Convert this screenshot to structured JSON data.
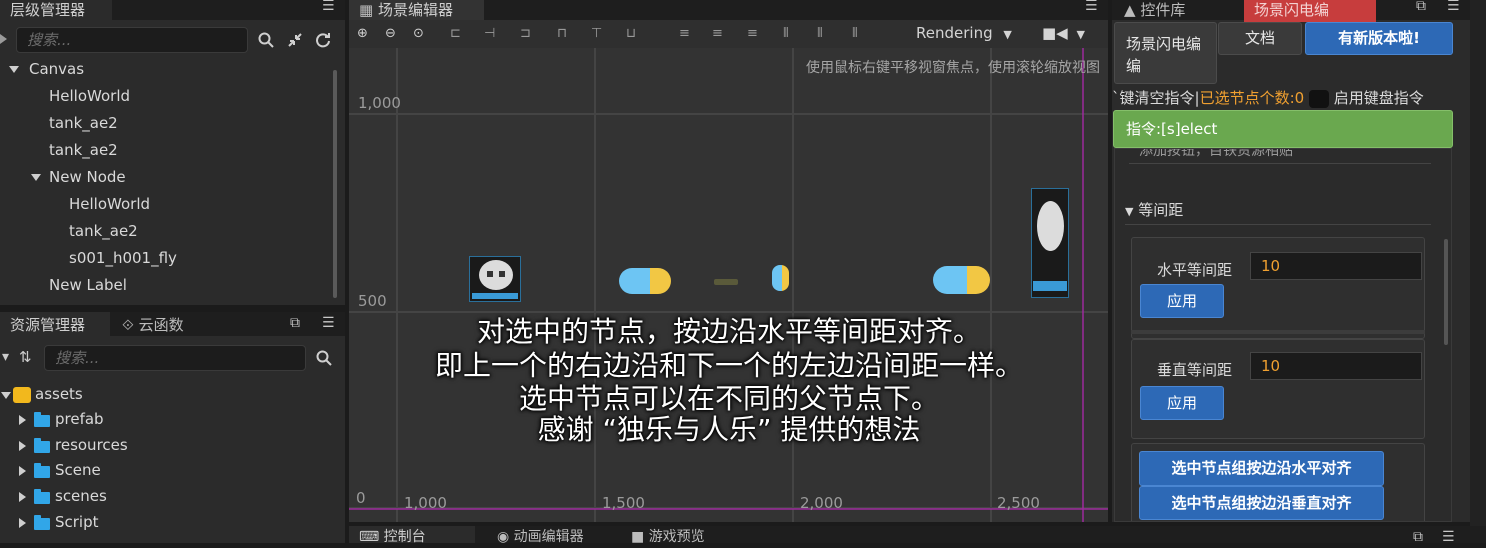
{
  "hierarchy": {
    "title": "层级管理器",
    "search_placeholder": "搜索...",
    "nodes": [
      "Canvas",
      "HelloWorld",
      "tank_ae2",
      "tank_ae2",
      "New Node",
      "HelloWorld",
      "tank_ae2",
      "s001_h001_fly",
      "New Label"
    ]
  },
  "assets": {
    "title": "资源管理器",
    "tab2": "云函数",
    "search_placeholder": "搜索...",
    "items": [
      "assets",
      "prefab",
      "resources",
      "Scene",
      "scenes",
      "Script"
    ]
  },
  "scene": {
    "title": "场景编辑器",
    "rendering": "Rendering",
    "hint": "使用鼠标右键平移视窗焦点，使用滚轮缩放视图",
    "y_labels": [
      "1,000",
      "500",
      "0"
    ],
    "x_labels": [
      "1,000",
      "1,500",
      "2,000",
      "2,500"
    ],
    "overlay": [
      "对选中的节点，按边沿水平等间距对齐。",
      "即上一个的右边沿和下一个的左边沿间距一样。",
      "选中节点可以在不同的父节点下。",
      "感谢 “独乐与人乐” 提供的想法"
    ]
  },
  "bottom_tabs": [
    "控制台",
    "动画编辑器",
    "游戏预览"
  ],
  "right": {
    "tab1": "控件库",
    "tab2": "场景闪电编",
    "btn_main": "场景闪电编",
    "btn_main2": "编",
    "btn_docs": "文档",
    "btn_update": "有新版本啦!",
    "status_prefix": "`键清空指令|",
    "status_selected": "已选节点个数:0",
    "status_suffix": "启用键盘指令",
    "command": "指令:[s]elect",
    "cut_text": "添加按钮，目铁资源相贴",
    "section": "等间距",
    "h_label": "水平等间距",
    "h_value": "10",
    "apply": "应用",
    "v_label": "垂直等间距",
    "v_value": "10",
    "apply2": "应用",
    "btn_align_h": "选中节点组按边沿水平对齐",
    "btn_align_v": "选中节点组按边沿垂直对齐"
  },
  "colors": {
    "accent_blue": "#2d69b6",
    "accent_green": "#6aa84f",
    "warn_orange": "#f0a030",
    "magenta_bounds": "#9c2b9c"
  }
}
